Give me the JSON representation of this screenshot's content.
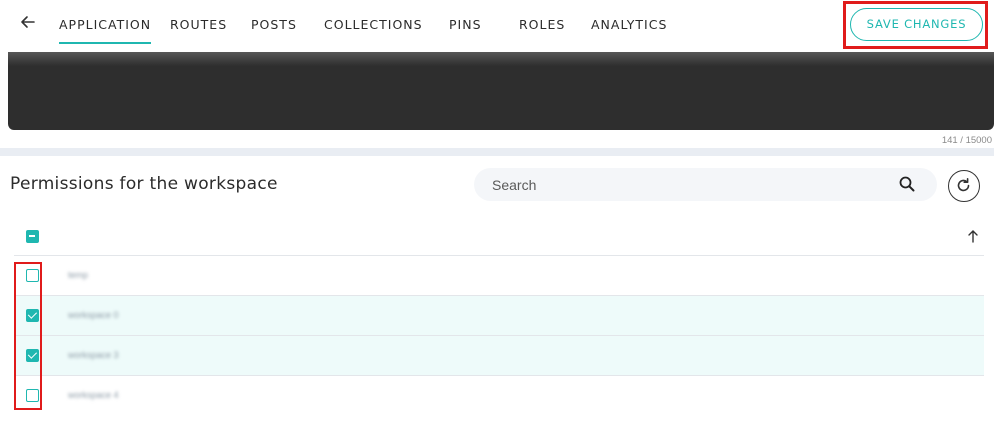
{
  "nav": {
    "back_icon": "arrow-left-icon",
    "tabs": [
      {
        "label": "APPLICATION",
        "active": true
      },
      {
        "label": "ROUTES",
        "active": false
      },
      {
        "label": "POSTS",
        "active": false
      },
      {
        "label": "COLLECTIONS",
        "active": false
      },
      {
        "label": "PINS",
        "active": false
      },
      {
        "label": "ROLES",
        "active": false
      },
      {
        "label": "ANALYTICS",
        "active": false
      }
    ],
    "save_label": "SAVE CHANGES"
  },
  "editor": {
    "char_count": "141 / 15000"
  },
  "permissions": {
    "title": "Permissions for the workspace",
    "search_placeholder": "Search",
    "rows": [
      {
        "label": "temp",
        "checked": false
      },
      {
        "label": "workspace 0",
        "checked": true
      },
      {
        "label": "workspace 3",
        "checked": true
      },
      {
        "label": "workspace 4",
        "checked": false
      }
    ],
    "select_all_state": "indeterminate"
  },
  "colors": {
    "accent": "#1fb7b0",
    "highlight": "#e01b1b",
    "editor_bg": "#2e2e2e",
    "selected_row_bg": "#eefbfa"
  }
}
